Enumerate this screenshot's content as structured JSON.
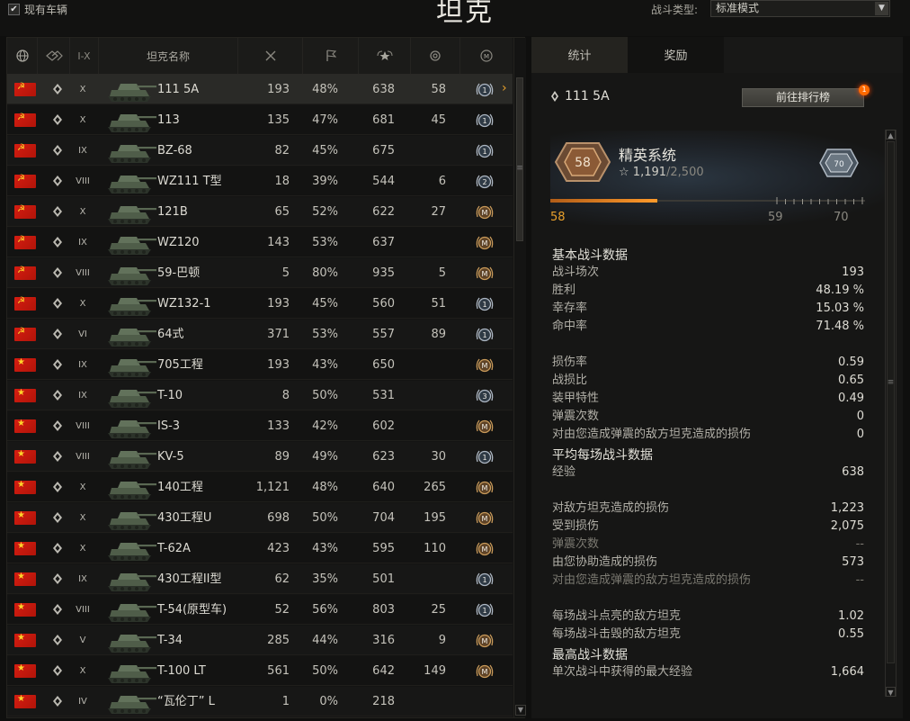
{
  "topbar": {
    "own_vehicles_label": "现有车辆",
    "title": "坦克",
    "battle_type_label": "战斗类型:",
    "battle_type_value": "标准模式"
  },
  "table": {
    "headers": {
      "tier": "I-X",
      "name": "坦克名称"
    },
    "rows": [
      {
        "nation": "ussr",
        "tier": "X",
        "name": "111 5A",
        "battles": "193",
        "win": "48%",
        "xp": "638",
        "dmg": "58",
        "mark": "1",
        "selected": true
      },
      {
        "nation": "ussr",
        "tier": "X",
        "name": "113",
        "battles": "135",
        "win": "47%",
        "xp": "681",
        "dmg": "45",
        "mark": "1"
      },
      {
        "nation": "ussr",
        "tier": "IX",
        "name": "BZ-68",
        "battles": "82",
        "win": "45%",
        "xp": "675",
        "dmg": "",
        "mark": "1"
      },
      {
        "nation": "ussr",
        "tier": "VIII",
        "name": "WZ111 T型",
        "battles": "18",
        "win": "39%",
        "xp": "544",
        "dmg": "6",
        "mark": "2"
      },
      {
        "nation": "ussr",
        "tier": "X",
        "name": "121B",
        "battles": "65",
        "win": "52%",
        "xp": "622",
        "dmg": "27",
        "mark": "M"
      },
      {
        "nation": "ussr",
        "tier": "IX",
        "name": "WZ120",
        "battles": "143",
        "win": "53%",
        "xp": "637",
        "dmg": "",
        "mark": "M"
      },
      {
        "nation": "ussr",
        "tier": "VIII",
        "name": "59-巴顿",
        "battles": "5",
        "win": "80%",
        "xp": "935",
        "dmg": "5",
        "mark": "M"
      },
      {
        "nation": "ussr",
        "tier": "X",
        "name": "WZ132-1",
        "battles": "193",
        "win": "45%",
        "xp": "560",
        "dmg": "51",
        "mark": "1"
      },
      {
        "nation": "ussr",
        "tier": "VI",
        "name": "64式",
        "battles": "371",
        "win": "53%",
        "xp": "557",
        "dmg": "89",
        "mark": "1"
      },
      {
        "nation": "star",
        "tier": "IX",
        "name": "705工程",
        "battles": "193",
        "win": "43%",
        "xp": "650",
        "dmg": "",
        "mark": "M"
      },
      {
        "nation": "star",
        "tier": "IX",
        "name": "T-10",
        "battles": "8",
        "win": "50%",
        "xp": "531",
        "dmg": "",
        "mark": "3"
      },
      {
        "nation": "star",
        "tier": "VIII",
        "name": "IS-3",
        "battles": "133",
        "win": "42%",
        "xp": "602",
        "dmg": "",
        "mark": "M"
      },
      {
        "nation": "star",
        "tier": "VIII",
        "name": "KV-5",
        "battles": "89",
        "win": "49%",
        "xp": "623",
        "dmg": "30",
        "mark": "1"
      },
      {
        "nation": "star",
        "tier": "X",
        "name": "140工程",
        "battles": "1,121",
        "win": "48%",
        "xp": "640",
        "dmg": "265",
        "mark": "M"
      },
      {
        "nation": "star",
        "tier": "X",
        "name": "430工程U",
        "battles": "698",
        "win": "50%",
        "xp": "704",
        "dmg": "195",
        "mark": "M"
      },
      {
        "nation": "star",
        "tier": "X",
        "name": "T-62A",
        "battles": "423",
        "win": "43%",
        "xp": "595",
        "dmg": "110",
        "mark": "M"
      },
      {
        "nation": "star",
        "tier": "IX",
        "name": "430工程II型",
        "battles": "62",
        "win": "35%",
        "xp": "501",
        "dmg": "",
        "mark": "1"
      },
      {
        "nation": "star",
        "tier": "VIII",
        "name": "T-54(原型车)",
        "battles": "52",
        "win": "56%",
        "xp": "803",
        "dmg": "25",
        "mark": "1"
      },
      {
        "nation": "star",
        "tier": "V",
        "name": "T-34",
        "battles": "285",
        "win": "44%",
        "xp": "316",
        "dmg": "9",
        "mark": "M"
      },
      {
        "nation": "star",
        "tier": "X",
        "name": "T-100 LT",
        "battles": "561",
        "win": "50%",
        "xp": "642",
        "dmg": "149",
        "mark": "M"
      },
      {
        "nation": "star",
        "tier": "IV",
        "name": "“瓦伦丁” L",
        "battles": "1",
        "win": "0%",
        "xp": "218",
        "dmg": "",
        "mark": ""
      }
    ]
  },
  "right": {
    "tabs": {
      "stats": "统计",
      "awards": "奖励"
    },
    "vehicle_name": "111 5A",
    "rank_button": "前往排行榜",
    "rank_badge": "1",
    "elite": {
      "title": "精英系统",
      "level": "58",
      "xp_current": "1,191",
      "xp_max": "/2,500",
      "target": "70",
      "progress_fraction": 0.4764,
      "label_current": "58",
      "label_next": "59",
      "label_max": "70"
    },
    "sections": [
      {
        "title": "基本战斗数据",
        "rows": [
          {
            "label": "战斗场次",
            "value": "193"
          },
          {
            "label": "胜利",
            "value": "48.19 %"
          },
          {
            "label": "幸存率",
            "value": "15.03 %"
          },
          {
            "label": "命中率",
            "value": "71.48 %"
          }
        ]
      },
      {
        "title": "",
        "rows": [
          {
            "label": "损伤率",
            "value": "0.59"
          },
          {
            "label": "战损比",
            "value": "0.65"
          },
          {
            "label": "装甲特性",
            "value": "0.49"
          },
          {
            "label": "弹震次数",
            "value": "0"
          },
          {
            "label": "对由您造成弹震的敌方坦克造成的损伤",
            "value": "0"
          }
        ]
      },
      {
        "title": "平均每场战斗数据",
        "rows": [
          {
            "label": "经验",
            "value": "638"
          }
        ]
      },
      {
        "title": "",
        "rows": [
          {
            "label": "对敌方坦克造成的损伤",
            "value": "1,223"
          },
          {
            "label": "受到损伤",
            "value": "2,075"
          },
          {
            "label": "弹震次数",
            "value": "--",
            "dim": true
          },
          {
            "label": "由您协助造成的损伤",
            "value": "573"
          },
          {
            "label": "对由您造成弹震的敌方坦克造成的损伤",
            "value": "--",
            "dim": true
          }
        ]
      },
      {
        "title": "",
        "rows": [
          {
            "label": "每场战斗点亮的敌方坦克",
            "value": "1.02"
          },
          {
            "label": "每场战斗击毁的敌方坦克",
            "value": "0.55"
          }
        ]
      },
      {
        "title": "最高战斗数据",
        "rows": [
          {
            "label": "单次战斗中获得的最大经验",
            "value": "1,664"
          }
        ]
      }
    ]
  },
  "colors": {
    "accent": "#e8a02c",
    "flag_red": "#d51d11"
  }
}
